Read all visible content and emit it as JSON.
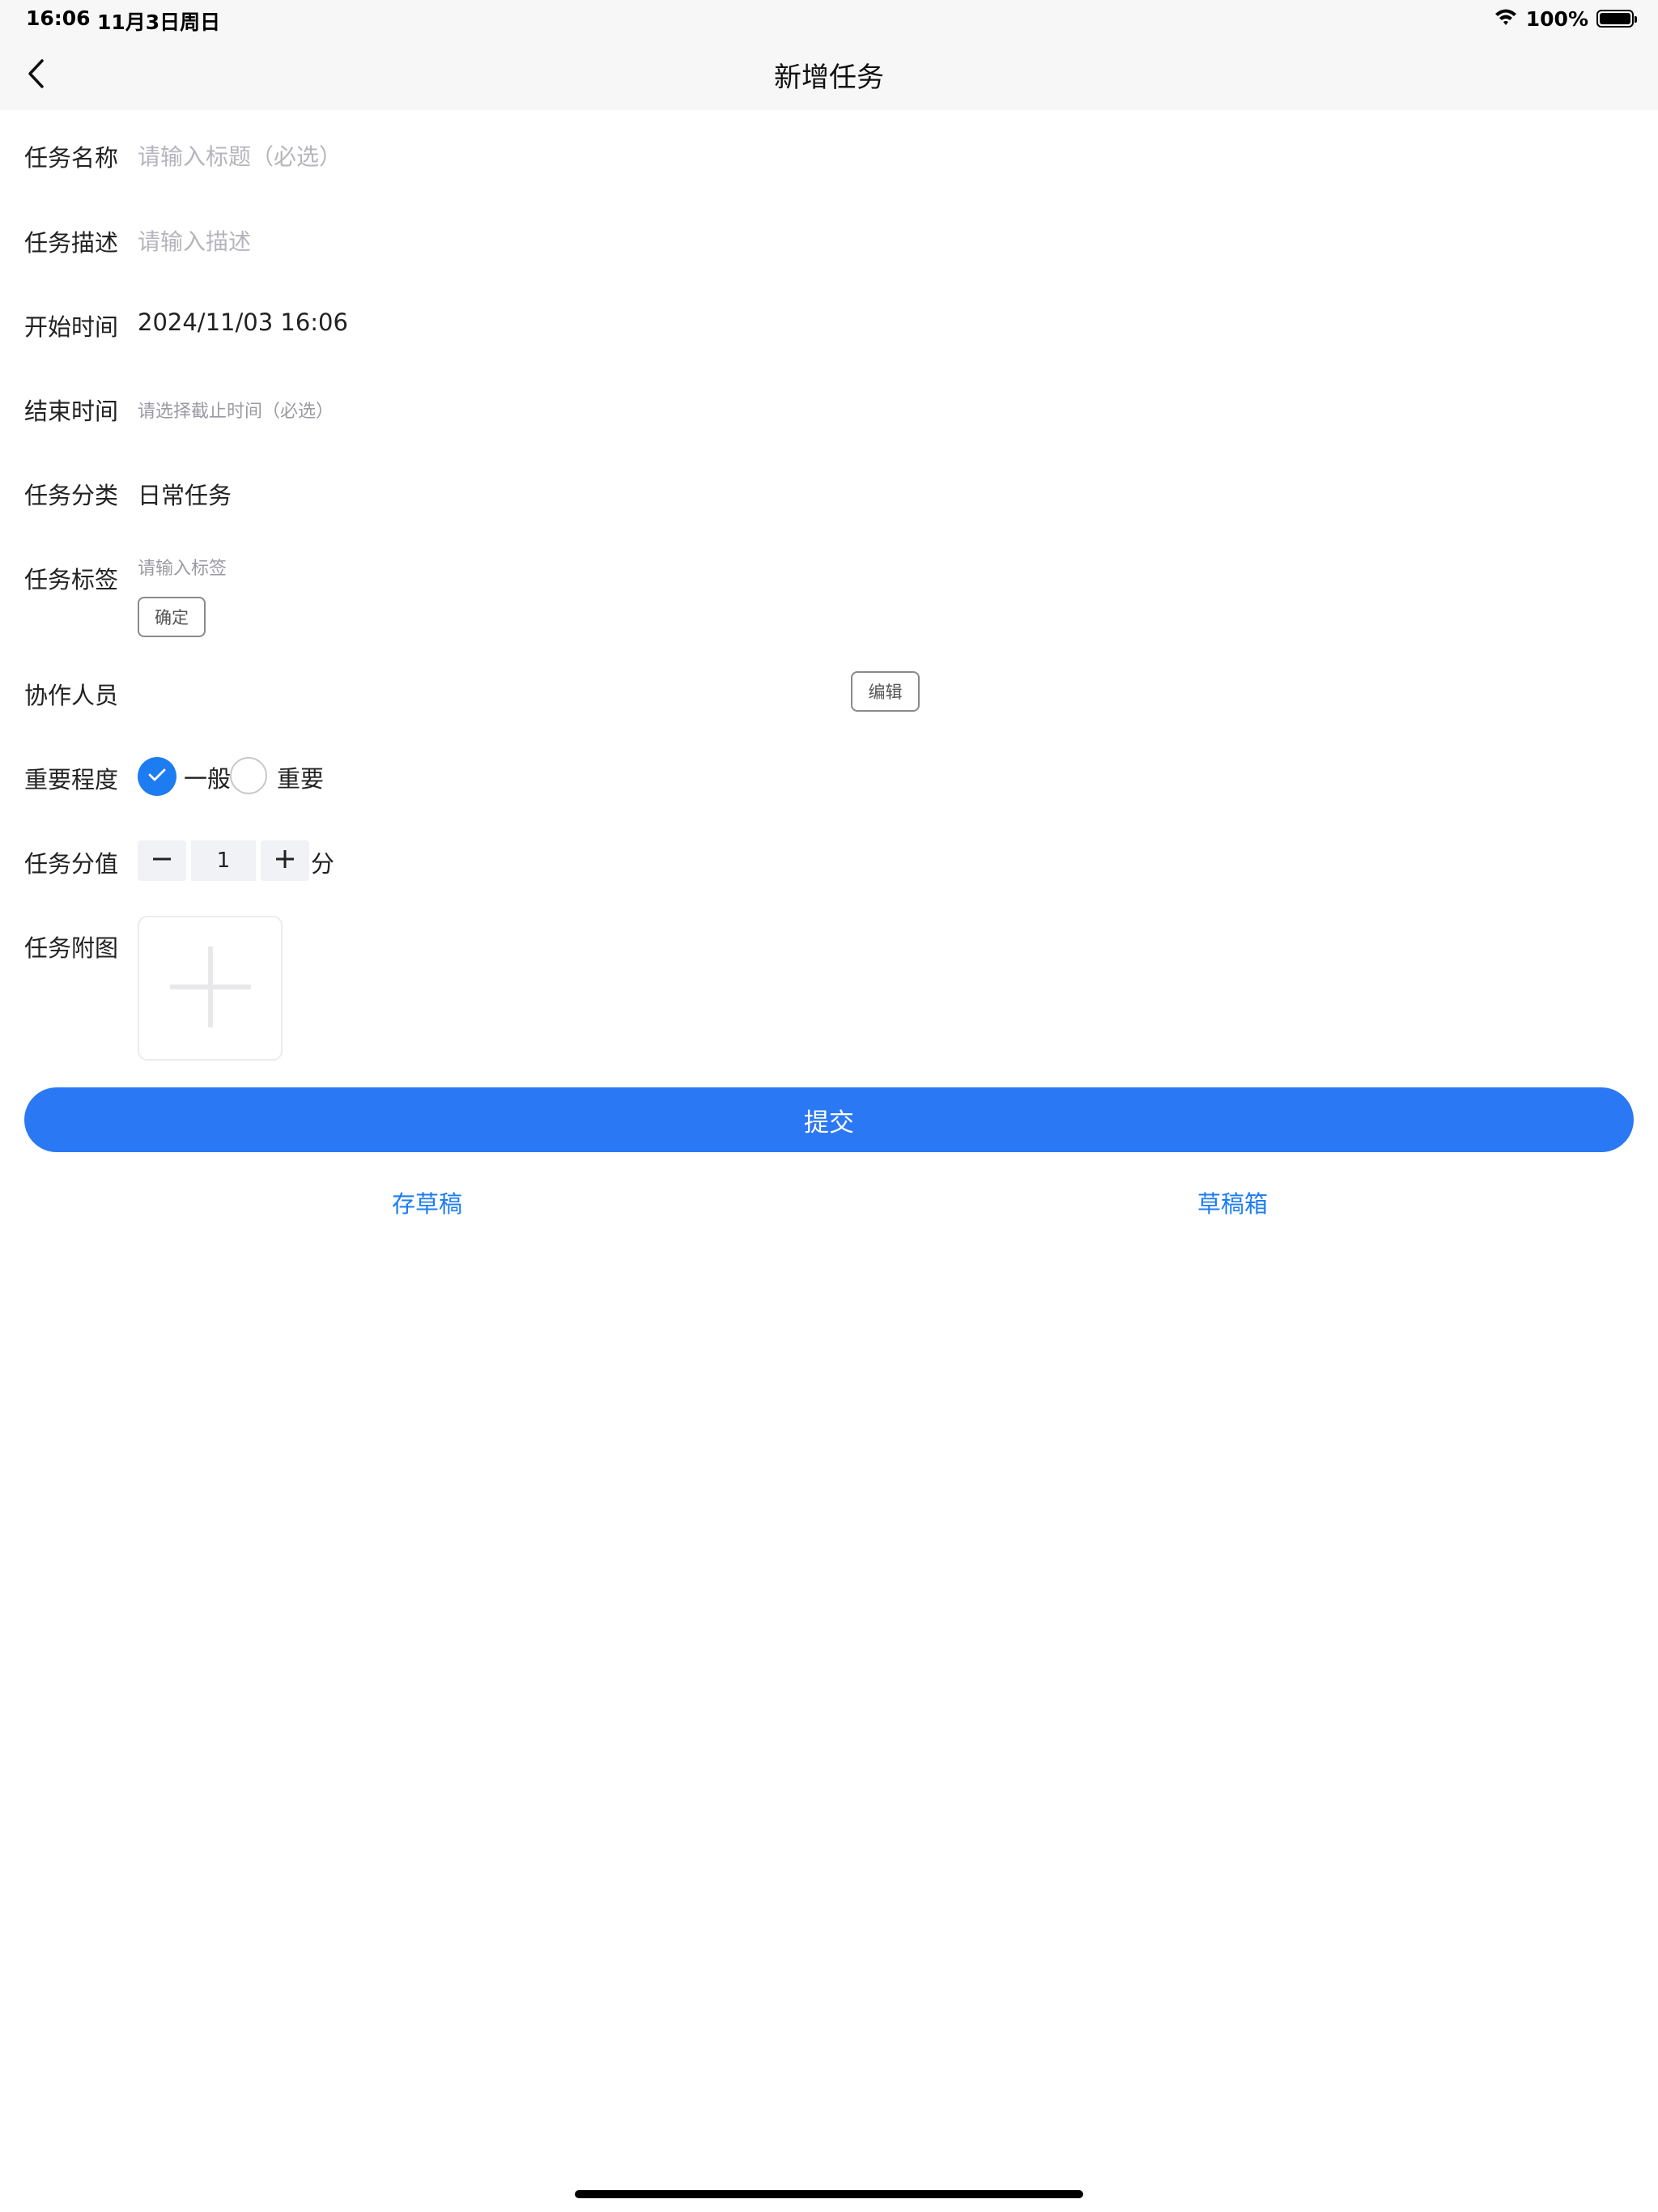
{
  "status_bar": {
    "time": "16:06",
    "date": "11月3日周日",
    "battery_percent": "100%"
  },
  "nav": {
    "title": "新增任务",
    "back_icon": "chevron-left-icon"
  },
  "form": {
    "task_name": {
      "label": "任务名称",
      "placeholder": "请输入标题（必选）"
    },
    "task_desc": {
      "label": "任务描述",
      "placeholder": "请输入描述"
    },
    "start_time": {
      "label": "开始时间",
      "value": "2024/11/03 16:06"
    },
    "end_time": {
      "label": "结束时间",
      "placeholder": "请选择截止时间（必选）"
    },
    "category": {
      "label": "任务分类",
      "value": "日常任务"
    },
    "tags": {
      "label": "任务标签",
      "placeholder": "请输入标签",
      "confirm_label": "确定"
    },
    "collaborators": {
      "label": "协作人员",
      "edit_label": "编辑"
    },
    "importance": {
      "label": "重要程度",
      "options": [
        "一般",
        "重要"
      ],
      "selected": "一般"
    },
    "score": {
      "label": "任务分值",
      "value": "1",
      "unit": "分"
    },
    "attachment": {
      "label": "任务附图"
    }
  },
  "actions": {
    "submit": "提交",
    "save_draft": "存草稿",
    "draft_box": "草稿箱"
  },
  "colors": {
    "accent": "#1d7cf2",
    "submit_bg": "#2a78f4",
    "placeholder": "#b5b5bd"
  }
}
